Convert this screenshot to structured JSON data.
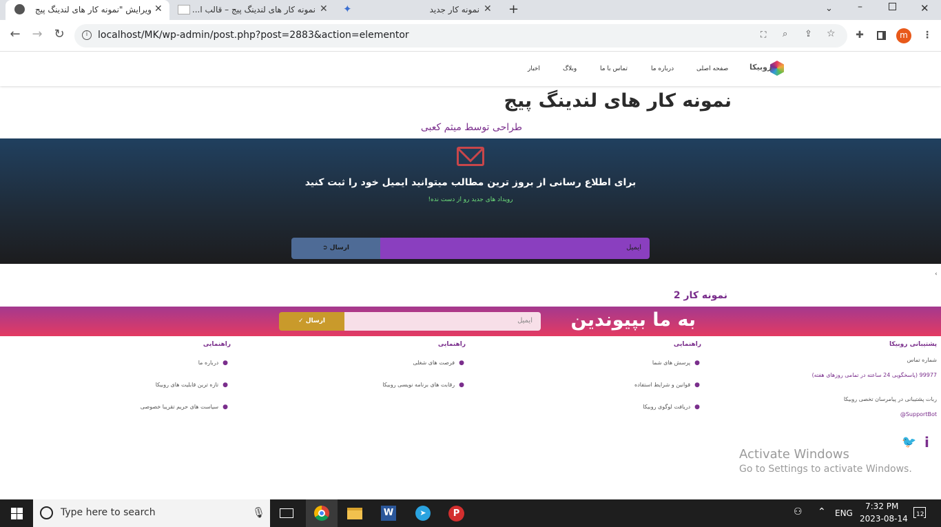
{
  "browser": {
    "tabs": [
      {
        "title": "ویرایش \"نمونه کار های لندینگ پیج"
      },
      {
        "title": "نمونه کار های لندینگ پیج – قالب ا..."
      },
      {
        "title": "نمونه کار جدید"
      }
    ],
    "url": "localhost/MK/wp-admin/post.php?post=2883&action=elementor",
    "profile_initial": "m"
  },
  "site": {
    "logo_text": "روبیکا",
    "menu": [
      "صفحه اصلی",
      "درباره ما",
      "تماس با ما",
      "وبلاگ",
      "اخبار"
    ],
    "title": "نمونه کار های لندینگ پیج",
    "subtitle": "طراحی توسط میثم کعبی",
    "newsletter": {
      "heading": "برای اطلاع رسانی از بروز ترین مطالب میتوانید ایمیل خود را ثبت کنید",
      "subtext": "رویداد های جدید رو از دست نده!",
      "email_placeholder": "ایمیل",
      "button": "ارسال"
    },
    "section2_title": "نمونه کار 2",
    "join": {
      "heading": "به ما بپیوندین",
      "email_placeholder": "ایمیل",
      "button": "ارسال"
    },
    "footer": {
      "support": {
        "title": "پشتیبانی روبیکا",
        "lines": [
          "شماره تماس",
          "99977 (پاسخگویی 24 ساعته در تمامی روزهای هفته)",
          "ربات پشتیبانی در پیامرسان تخصی روبیکا",
          "SupportBot@"
        ]
      },
      "col2": {
        "title": "راهنمایی",
        "links": [
          "پرسش های شما",
          "قوانین و شرایط استفاده",
          "دریافت لوگوی روبیکا"
        ]
      },
      "col3": {
        "title": "راهنمایی",
        "links": [
          "فرصت های شغلی",
          "رقابت های برنامه نویسی روبیکا"
        ]
      },
      "col4": {
        "title": "راهنمایی",
        "links": [
          "درباره ما",
          "تازه ترین قابلیت های روبیکا",
          "سیاست های حریم تقریبا خصوصی"
        ]
      }
    },
    "watermark": {
      "line1": "Activate Windows",
      "line2": "Go to Settings to activate Windows."
    }
  },
  "taskbar": {
    "search_placeholder": "Type here to search",
    "lang": "ENG",
    "time": "7:32 PM",
    "date": "2023-08-14",
    "notifications": "12"
  },
  "colors": {
    "accent": "#7a2e8c",
    "newsletter_btn": "#4e6b96",
    "join_btn": "#c99a2b"
  }
}
